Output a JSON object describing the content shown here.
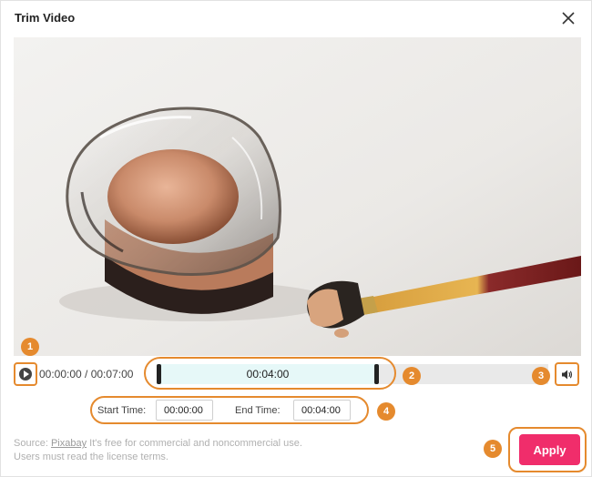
{
  "dialog": {
    "title": "Trim Video",
    "close_icon": "close-icon"
  },
  "player": {
    "play_icon": "play-icon",
    "time_display": "00:00:00 / 00:07:00",
    "selection_duration": "00:04:00",
    "volume_icon": "volume-icon"
  },
  "trim": {
    "start_label": "Start Time:",
    "start_value": "00:00:00",
    "end_label": "End Time:",
    "end_value": "00:04:00"
  },
  "source": {
    "prefix": "Source: ",
    "link_text": "Pixabay",
    "suffix": " It's free for commercial and noncommercial use.",
    "line2": "Users must read the license terms."
  },
  "apply_label": "Apply",
  "badges": [
    "1",
    "2",
    "3",
    "4",
    "5"
  ],
  "colors": {
    "accent_orange": "#e58a2e",
    "apply_pink": "#f02d6b",
    "trim_region": "#e6f8f8"
  }
}
